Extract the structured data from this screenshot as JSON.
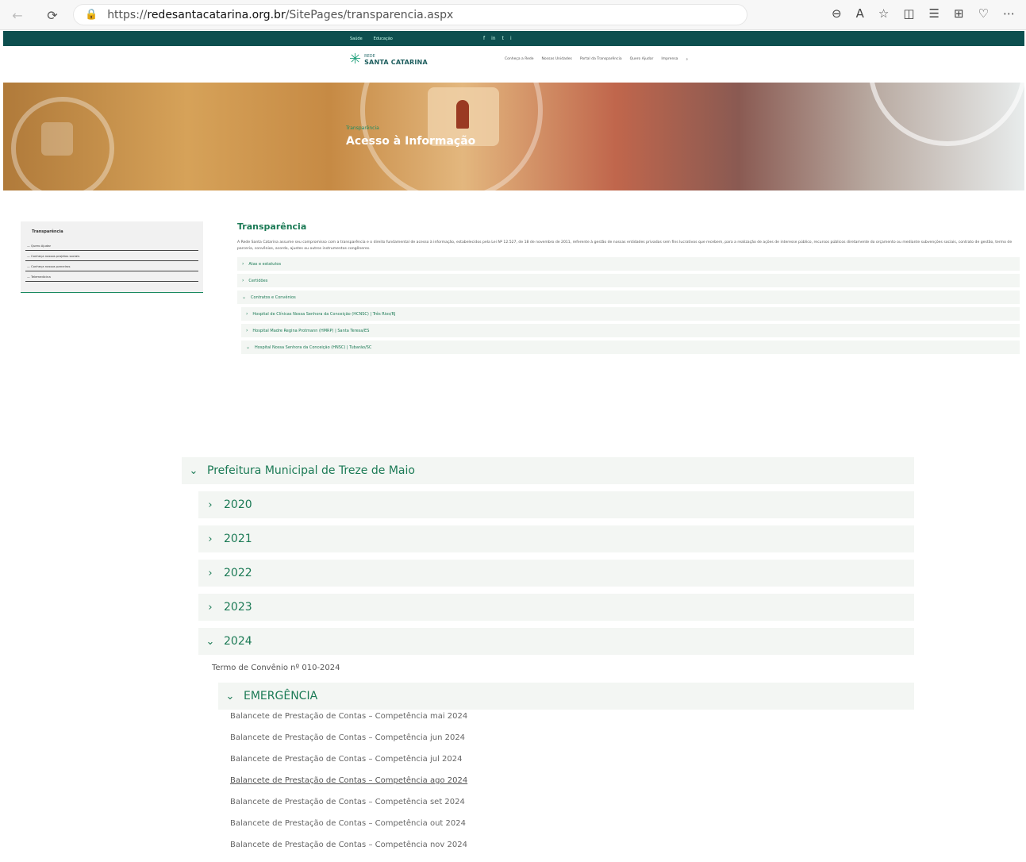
{
  "browser": {
    "url_prefix": "https://",
    "url_host": "redesantacatarina.org.br",
    "url_path": "/SitePages/transparencia.aspx"
  },
  "topbar": {
    "links": [
      "Saúde",
      "Educação"
    ],
    "social": [
      "f",
      "in",
      "t",
      "i"
    ]
  },
  "nav": {
    "logo_small": "REDE",
    "logo_name": "SANTA CATARINA",
    "menu": [
      "Conheça a Rede",
      "Nossas Unidades",
      "Portal da Transparência",
      "Quero Ajudar",
      "Imprensa"
    ]
  },
  "hero": {
    "breadcrumb": "Transparência",
    "title": "Acesso à Informação"
  },
  "sidebar": {
    "title": "Transparência",
    "items": [
      "Quero Ajudar",
      "Conheça nossos projetos sociais",
      "Conheça nossos parceiros",
      "Telemedicina"
    ]
  },
  "main": {
    "heading": "Transparência",
    "intro": "A Rede Santa Catarina assume seu compromisso com a transparência e o direito fundamental de acesso à informação, estabelecidos pela Lei Nº 12.527, de 18 de novembro de 2011, referente à gestão de nossas entidades privadas sem fins lucrativos que recebem, para a realização de ações de interesse público, recursos públicos diretamente do orçamento ou mediante subvenções sociais, contrato de gestão, termo de parceria, convênios, acordo, ajustes ou outros instrumentos congêneres.",
    "accordion": [
      {
        "label": "Atas e estatutos",
        "open": false
      },
      {
        "label": "Certidões",
        "open": false
      },
      {
        "label": "Contratos e Convênios",
        "open": true
      }
    ],
    "sub_accordion": [
      {
        "label": "Hospital de Clínicas Nossa Senhora da Conceição (HCNSC) | Três Rios/RJ",
        "open": false
      },
      {
        "label": "Hospital Madre Regina Protmann (HMRP) | Santa Teresa/ES",
        "open": false
      },
      {
        "label": "Hospital Nossa Senhora da Conceição (HNSC) | Tubarão/SC",
        "open": true
      }
    ]
  },
  "zoom": {
    "section": "Prefeitura Municipal de Treze de Maio",
    "years": [
      {
        "label": "2020",
        "open": false
      },
      {
        "label": "2021",
        "open": false
      },
      {
        "label": "2022",
        "open": false
      },
      {
        "label": "2023",
        "open": false
      },
      {
        "label": "2024",
        "open": true
      }
    ],
    "term": "Termo de Convênio nº 010-2024",
    "category": "EMERGÊNCIA",
    "links": [
      "Balancete de Prestação de Contas – Competência mai 2024",
      "Balancete de Prestação de Contas – Competência jun 2024",
      "Balancete de Prestação de Contas – Competência jul 2024",
      "Balancete de Prestação de Contas – Competência ago 2024",
      "Balancete de Prestação de Contas – Competência set 2024",
      "Balancete de Prestação de Contas – Competência out 2024",
      "Balancete de Prestação de Contas – Competência nov 2024"
    ],
    "hovered_link_index": 3
  }
}
